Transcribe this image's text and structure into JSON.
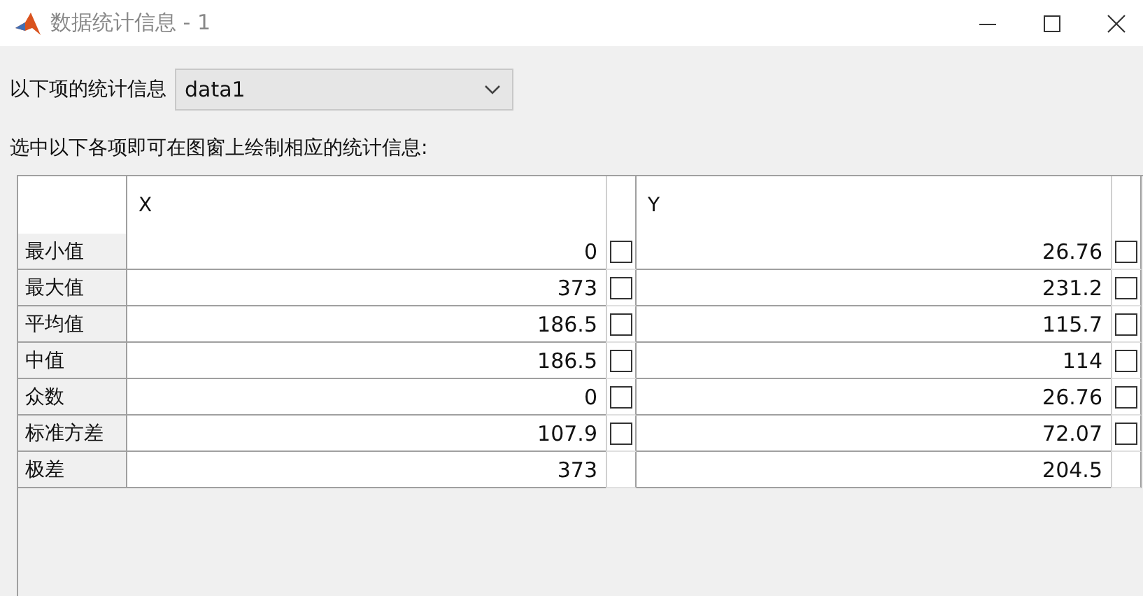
{
  "window": {
    "title": "数据统计信息 - 1"
  },
  "selector": {
    "label": "以下项的统计信息",
    "value": "data1"
  },
  "instruction": "选中以下各项即可在图窗上绘制相应的统计信息:",
  "table": {
    "columns": [
      "X",
      "Y"
    ],
    "rows": [
      {
        "label": "最小值",
        "kind": "checkable",
        "x": {
          "value": "0",
          "checked": false
        },
        "y": {
          "value": "26.76",
          "checked": false
        }
      },
      {
        "label": "最大值",
        "kind": "checkable",
        "x": {
          "value": "373",
          "checked": false
        },
        "y": {
          "value": "231.2",
          "checked": false
        }
      },
      {
        "label": "平均值",
        "kind": "checkable",
        "x": {
          "value": "186.5",
          "checked": false
        },
        "y": {
          "value": "115.7",
          "checked": false
        }
      },
      {
        "label": "中值",
        "kind": "checkable",
        "x": {
          "value": "186.5",
          "checked": false
        },
        "y": {
          "value": "114",
          "checked": false
        }
      },
      {
        "label": "众数",
        "kind": "checkable",
        "x": {
          "value": "0",
          "checked": false
        },
        "y": {
          "value": "26.76",
          "checked": false
        }
      },
      {
        "label": "标准方差",
        "kind": "checkable",
        "x": {
          "value": "107.9",
          "checked": false
        },
        "y": {
          "value": "72.07",
          "checked": false
        }
      },
      {
        "label": "极差",
        "kind": "plain",
        "x": {
          "value": "373"
        },
        "y": {
          "value": "204.5"
        }
      }
    ]
  }
}
